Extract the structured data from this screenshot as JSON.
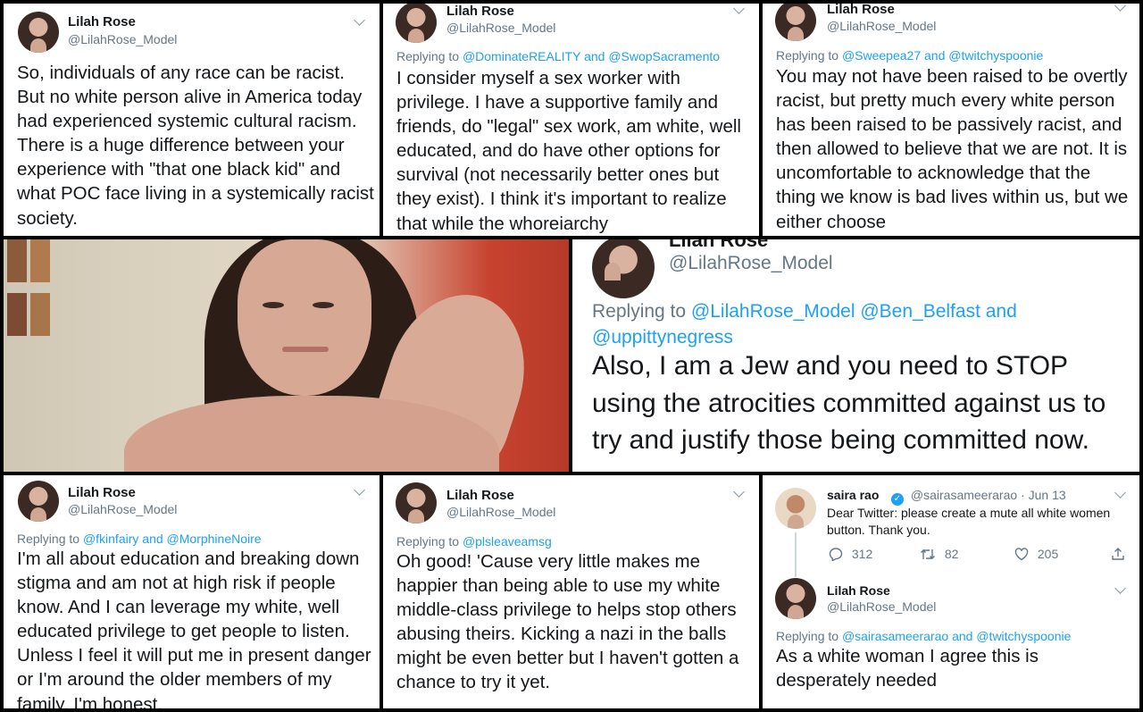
{
  "common": {
    "name": "Lilah Rose",
    "handle": "@LilahRose_Model",
    "replying": "Replying to",
    "and": "and"
  },
  "t1": {
    "body": "So,  individuals of any race can be racist. But no white person alive in America today had experienced systemic cultural racism. There is a huge difference between your experience with \"that one black kid\" and what POC face living in a systemically racist society."
  },
  "t2": {
    "reply_a": "@DominateREALITY",
    "reply_b": "@SwopSacramento",
    "body": "I consider myself a sex worker with privilege.  I have a supportive family and friends, do \"legal\" sex work, am white, well educated, and do have other options for survival (not necessarily better ones but they exist). I think it's important to realize that while the whoreiarchy"
  },
  "t3": {
    "reply_a": "@Sweepea27",
    "reply_b": "@twitchyspoonie",
    "body": "You may not have been raised to be overtly racist, but pretty much every white person has been raised to be passively racist, and then allowed to believe that we are not. It is uncomfortable to acknowledge that the thing we know is bad lives within us, but we either choose"
  },
  "t4": {
    "reply_a": "@LilahRose_Model",
    "reply_b": "@Ben_Belfast",
    "reply_c": "@uppittynegress",
    "body": "Also,  I am a Jew and you need to STOP using the atrocities committed against us to try and justify those being committed now."
  },
  "t5": {
    "reply_a": "@fkinfairy",
    "reply_b": "@MorphineNoire",
    "body": "I'm all about education and breaking down stigma and am not at high risk if people know. And I can leverage my white, well educated privilege to get people to listen. Unless I feel it will put me in present danger or I'm around the older members of my family, I'm honest."
  },
  "t6": {
    "reply_a": "@plsleaveamsg",
    "body": "Oh good! 'Cause very little makes me happier than being able to use my white middle-class privilege to helps stop others abusing theirs. Kicking a nazi in the balls might be even better but I haven't gotten a chance to try it yet."
  },
  "t7": {
    "name": "saira rao",
    "verified": "✓",
    "handle": "@sairasameerarao",
    "dot": "·",
    "date": "Jun 13",
    "body": "Dear Twitter: please create a mute all white women button. Thank you.",
    "replies": "312",
    "retweets": "82",
    "likes": "205"
  },
  "t8": {
    "reply_a": "@sairasameerarao",
    "reply_b": "@twitchyspoonie",
    "body": "As a white woman I agree this is desperately needed"
  }
}
